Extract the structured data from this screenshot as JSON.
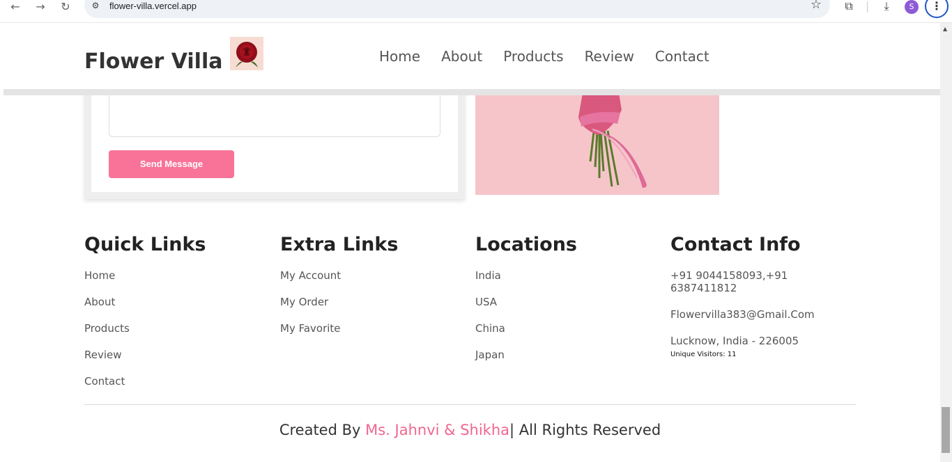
{
  "browser": {
    "url": "flower-villa.vercel.app",
    "profile_initial": "S"
  },
  "header": {
    "brand": "Flower Villa",
    "nav": [
      "Home",
      "About",
      "Products",
      "Review",
      "Contact"
    ]
  },
  "contact_form": {
    "send_label": "Send Message"
  },
  "footer": {
    "quick_links": {
      "title": "Quick Links",
      "items": [
        "Home",
        "About",
        "Products",
        "Review",
        "Contact"
      ]
    },
    "extra_links": {
      "title": "Extra Links",
      "items": [
        "My Account",
        "My Order",
        "My Favorite"
      ]
    },
    "locations": {
      "title": "Locations",
      "items": [
        "India",
        "USA",
        "China",
        "Japan"
      ]
    },
    "contact_info": {
      "title": "Contact Info",
      "phone": "+91 9044158093,+91 6387411812",
      "email": "Flowervilla383@Gmail.Com",
      "address": "Lucknow, India - 226005",
      "visitors": "Unique Visitors: 11"
    },
    "credit_prefix": "Created By ",
    "credit_authors": "Ms. Jahnvi & Shikha",
    "credit_suffix": "| All Rights Reserved"
  },
  "colors": {
    "accent_pink": "#f87397",
    "credit_pink": "#f0668f"
  }
}
